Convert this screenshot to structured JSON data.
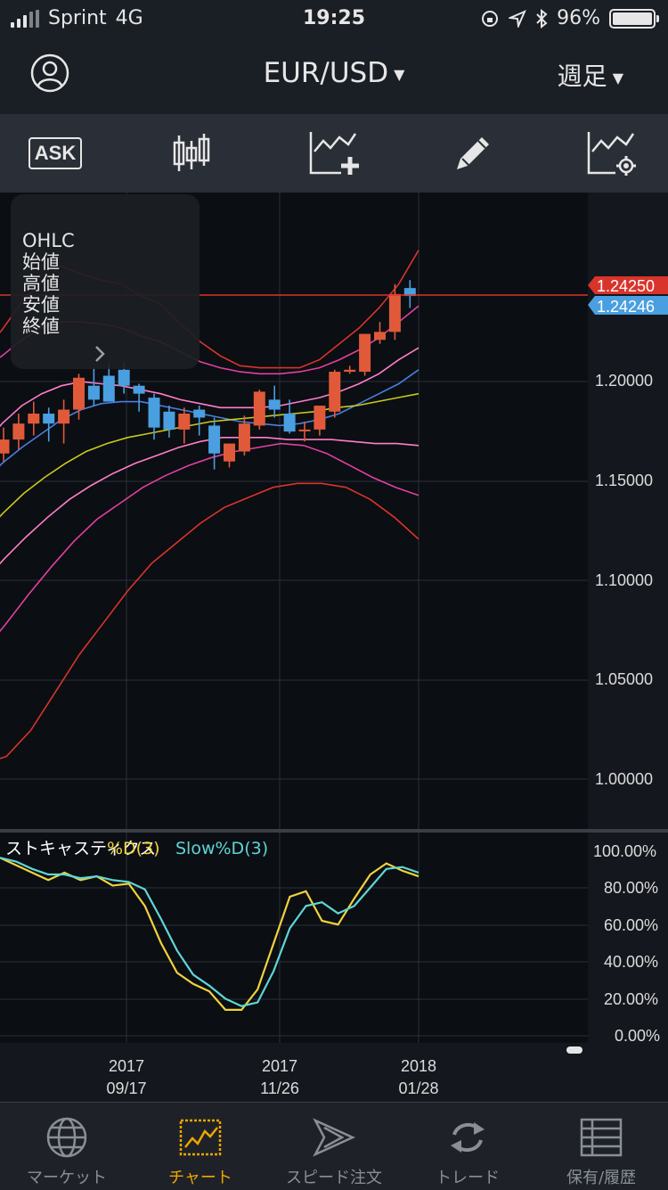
{
  "status": {
    "carrier": "Sprint",
    "network": "4G",
    "time": "19:25",
    "battery": "96%"
  },
  "nav": {
    "pair": "EUR/USD",
    "period": "週足"
  },
  "toolbar": {
    "ask_label": "ASK"
  },
  "ohlc_panel": {
    "title": "OHLC",
    "open": "始値",
    "high": "高値",
    "low": "安値",
    "close": "終値"
  },
  "price_axis": [
    "1.20000",
    "1.15000",
    "1.10000",
    "1.05000",
    "1.00000"
  ],
  "price_tags": {
    "ask": "1.24250",
    "bid": "1.24246"
  },
  "oscillator": {
    "name": "ストキャスティクス",
    "k_label": "%D(3)",
    "d_label": "Slow%D(3)",
    "axis": [
      "100.00%",
      "80.00%",
      "60.00%",
      "40.00%",
      "20.00%",
      "0.00%"
    ]
  },
  "date_axis": [
    {
      "year": "2017",
      "date": "09/17"
    },
    {
      "year": "2017",
      "date": "11/26"
    },
    {
      "year": "2018",
      "date": "01/28"
    }
  ],
  "tabs": [
    {
      "label": "マーケット",
      "icon": "globe-icon"
    },
    {
      "label": "チャート",
      "icon": "chart-icon"
    },
    {
      "label": "スピード注文",
      "icon": "speed-arrow-icon"
    },
    {
      "label": "トレード",
      "icon": "refresh-arrows-icon"
    },
    {
      "label": "保有/履歴",
      "icon": "list-icon"
    }
  ],
  "colors": {
    "bull": "#e05a3a",
    "bear": "#4a9fe0",
    "accent": "#f0a500",
    "stoch_k": "#f0d23c",
    "stoch_d": "#5fd6d6"
  },
  "chart_data": {
    "type": "candlestick",
    "period": "weekly",
    "y_range": [
      0.98,
      1.27
    ],
    "candles_ohlc": [
      [
        1.163,
        1.176,
        1.159,
        1.17
      ],
      [
        1.17,
        1.183,
        1.165,
        1.178
      ],
      [
        1.178,
        1.189,
        1.172,
        1.183
      ],
      [
        1.183,
        1.186,
        1.169,
        1.178
      ],
      [
        1.178,
        1.19,
        1.168,
        1.185
      ],
      [
        1.185,
        1.203,
        1.18,
        1.201
      ],
      [
        1.197,
        1.206,
        1.187,
        1.19
      ],
      [
        1.202,
        1.209,
        1.19,
        1.189
      ],
      [
        1.205,
        1.209,
        1.193,
        1.197
      ],
      [
        1.197,
        1.198,
        1.184,
        1.193
      ],
      [
        1.191,
        1.193,
        1.17,
        1.176
      ],
      [
        1.184,
        1.187,
        1.171,
        1.175
      ],
      [
        1.175,
        1.186,
        1.168,
        1.183
      ],
      [
        1.185,
        1.187,
        1.172,
        1.181
      ],
      [
        1.177,
        1.181,
        1.155,
        1.163
      ],
      [
        1.159,
        1.168,
        1.156,
        1.168
      ],
      [
        1.164,
        1.182,
        1.162,
        1.178
      ],
      [
        1.177,
        1.195,
        1.175,
        1.194
      ],
      [
        1.19,
        1.197,
        1.181,
        1.185
      ],
      [
        1.183,
        1.19,
        1.173,
        1.174
      ],
      [
        1.175,
        1.179,
        1.169,
        1.175
      ],
      [
        1.175,
        1.186,
        1.172,
        1.187
      ],
      [
        1.184,
        1.205,
        1.181,
        1.204
      ],
      [
        1.204,
        1.207,
        1.203,
        1.205
      ],
      [
        1.204,
        1.222,
        1.202,
        1.223
      ],
      [
        1.22,
        1.229,
        1.218,
        1.224
      ],
      [
        1.224,
        1.248,
        1.22,
        1.243
      ],
      [
        1.246,
        1.25,
        1.236,
        1.242
      ]
    ],
    "bands": [
      {
        "name": "upper-3sd",
        "color": "#d9342b",
        "values": [
          1.214,
          1.225,
          1.239,
          1.249,
          1.257,
          1.253,
          1.25,
          1.248,
          1.242,
          1.238,
          1.228,
          1.219,
          1.212,
          1.207,
          1.206,
          1.206,
          1.206,
          1.21,
          1.218,
          1.226,
          1.236,
          1.248,
          1.265
        ]
      },
      {
        "name": "upper-2sd",
        "color": "#e040a0",
        "values": [
          1.205,
          1.212,
          1.22,
          1.226,
          1.229,
          1.229,
          1.228,
          1.226,
          1.222,
          1.219,
          1.214,
          1.209,
          1.206,
          1.204,
          1.203,
          1.203,
          1.204,
          1.206,
          1.21,
          1.215,
          1.221,
          1.229,
          1.237
        ]
      },
      {
        "name": "upper-1sd",
        "color": "#ff7ec8",
        "values": [
          1.166,
          1.178,
          1.187,
          1.193,
          1.197,
          1.199,
          1.198,
          1.197,
          1.195,
          1.193,
          1.19,
          1.188,
          1.186,
          1.186,
          1.186,
          1.187,
          1.189,
          1.191,
          1.194,
          1.198,
          1.203,
          1.21,
          1.216
        ]
      },
      {
        "name": "sma",
        "color": "#4a7fe0",
        "values": [
          1.148,
          1.158,
          1.166,
          1.173,
          1.18,
          1.185,
          1.188,
          1.189,
          1.189,
          1.187,
          1.185,
          1.183,
          1.181,
          1.179,
          1.178,
          1.177,
          1.178,
          1.18,
          1.183,
          1.188,
          1.193,
          1.198,
          1.205
        ]
      },
      {
        "name": "mid",
        "color": "#c9c91c",
        "values": [
          1.122,
          1.133,
          1.143,
          1.151,
          1.158,
          1.164,
          1.168,
          1.171,
          1.173,
          1.175,
          1.177,
          1.179,
          1.18,
          1.181,
          1.182,
          1.183,
          1.184,
          1.186,
          1.187,
          1.189,
          1.191,
          1.193
        ]
      },
      {
        "name": "lower-1sd",
        "color": "#ff7ec8",
        "values": [
          1.098,
          1.11,
          1.121,
          1.131,
          1.14,
          1.147,
          1.153,
          1.158,
          1.162,
          1.166,
          1.169,
          1.171,
          1.171,
          1.171,
          1.17,
          1.17,
          1.17,
          1.169,
          1.168,
          1.168,
          1.167
        ]
      },
      {
        "name": "lower-2sd",
        "color": "#e040a0",
        "values": [
          1.063,
          1.077,
          1.092,
          1.106,
          1.119,
          1.13,
          1.138,
          1.146,
          1.152,
          1.157,
          1.161,
          1.164,
          1.166,
          1.168,
          1.167,
          1.163,
          1.157,
          1.151,
          1.146,
          1.142
        ]
      },
      {
        "name": "lower-3sd",
        "color": "#d9342b",
        "values": [
          1.007,
          1.011,
          1.024,
          1.043,
          1.062,
          1.078,
          1.094,
          1.108,
          1.118,
          1.128,
          1.136,
          1.141,
          1.146,
          1.148,
          1.148,
          1.146,
          1.14,
          1.131,
          1.12
        ]
      }
    ],
    "stochastic": {
      "k": [
        96,
        92,
        88,
        84,
        88,
        84,
        86,
        81,
        82,
        70,
        50,
        34,
        28,
        24,
        14,
        14,
        25,
        50,
        75,
        78,
        62,
        60,
        74,
        87,
        93,
        89,
        86
      ],
      "d": [
        96,
        94,
        90,
        87,
        87,
        85,
        86,
        84,
        83,
        79,
        63,
        46,
        33,
        27,
        20,
        16,
        18,
        35,
        58,
        70,
        72,
        66,
        70,
        80,
        90,
        91,
        88
      ]
    }
  }
}
